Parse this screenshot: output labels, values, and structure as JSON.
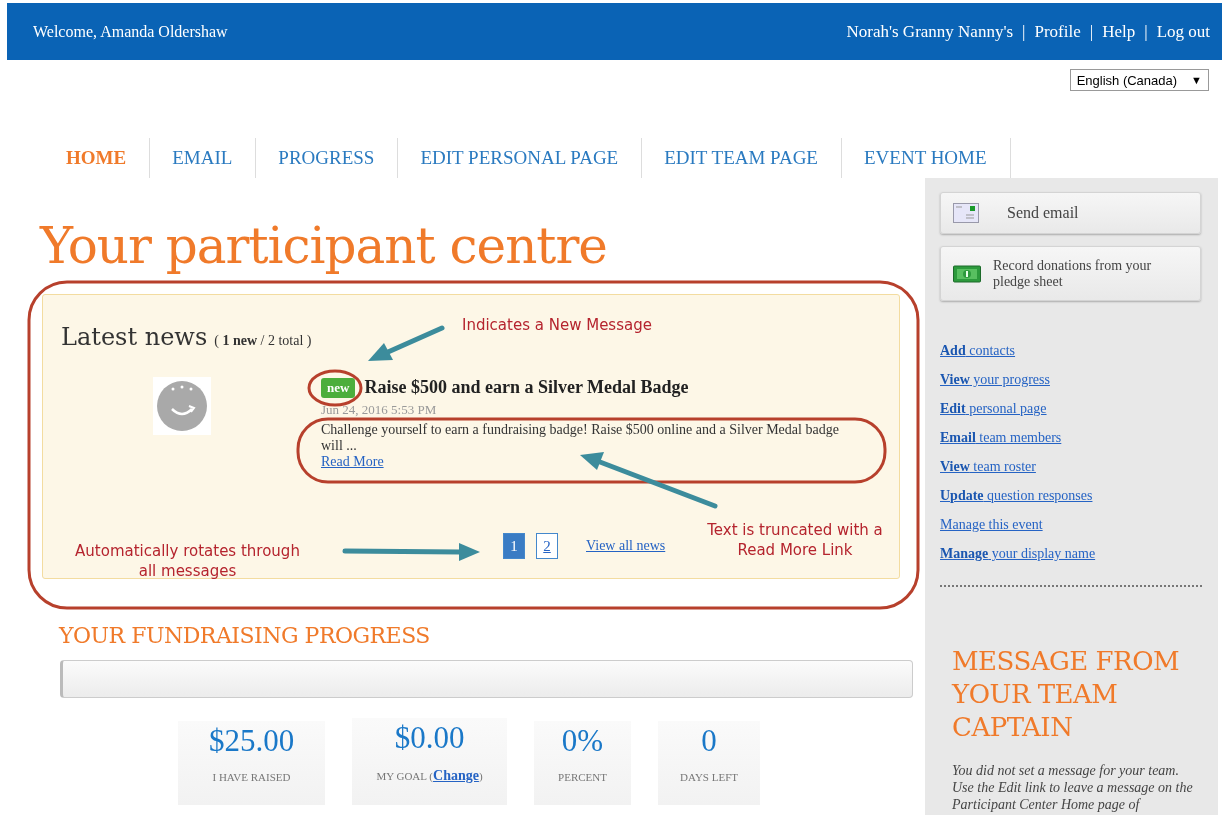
{
  "header": {
    "welcome": "Welcome,  Amanda Oldershaw",
    "links": [
      {
        "label": "Norah's Granny Nanny's",
        "separator": "|"
      },
      {
        "label": "Profile",
        "separator": "|"
      },
      {
        "label": "Help",
        "separator": "|"
      },
      {
        "label": "Log out"
      }
    ]
  },
  "language": {
    "value": "English (Canada)",
    "caret": "▼"
  },
  "tabs": [
    {
      "label": "HOME",
      "selected": true
    },
    {
      "label": "EMAIL",
      "selected": false
    },
    {
      "label": "PROGRESS",
      "selected": false
    },
    {
      "label": "EDIT PERSONAL PAGE",
      "selected": false
    },
    {
      "label": "EDIT TEAM PAGE",
      "selected": false
    },
    {
      "label": "EVENT HOME",
      "selected": false
    }
  ],
  "title": "Your participant centre",
  "news": {
    "heading": "Latest news",
    "count": "( **1 new** / 2 total )",
    "item": {
      "badge": "new",
      "title": "Raise $500 and earn a Silver Medal Badge",
      "date": "Jun 24, 2016 5:53 PM",
      "body": "Challenge yourself to earn a fundraising badge! Raise $500 online and a Silver Medal badge will ...",
      "read_more": "Read More"
    },
    "pages": [
      {
        "label": "1",
        "selected": true
      },
      {
        "label": "2",
        "selected": false
      }
    ],
    "view_all": "View all news"
  },
  "progress": {
    "heading": "YOUR FUNDRAISING PROGRESS",
    "level": 0,
    "stats": [
      {
        "value": "$25.00",
        "label": "I HAVE RAISED"
      },
      {
        "value": "$0.00",
        "label": "MY GOAL (",
        "link": "Change",
        "label_after": ")"
      },
      {
        "value": "0%",
        "label": "PERCENT"
      },
      {
        "value": "0",
        "label": "DAYS LEFT"
      }
    ]
  },
  "sidebar": {
    "buttons": [
      {
        "kind": "email",
        "label": "Send email"
      },
      {
        "kind": "money",
        "label": "Record donations from your pledge sheet"
      }
    ],
    "links": [
      "**Add** contacts",
      "**View** your progress",
      "**Edit** personal page",
      "**Email** team members",
      "**View** team roster",
      "**Update** question responses",
      "Manage this event",
      "**Manage** your display name"
    ],
    "captain": {
      "heading": "MESSAGE FROM YOUR TEAM CAPTAIN",
      "text": "You did not set a message for your team. Use the Edit link to leave a message on the Participant Center Home page of"
    }
  },
  "annotations": [
    {
      "kind": "new",
      "text": "Indicates a New Message"
    },
    {
      "kind": "truncated",
      "text": "Text is truncated with a Read More Link"
    },
    {
      "kind": "rotate",
      "text": "Automatically rotates through all messages"
    }
  ]
}
